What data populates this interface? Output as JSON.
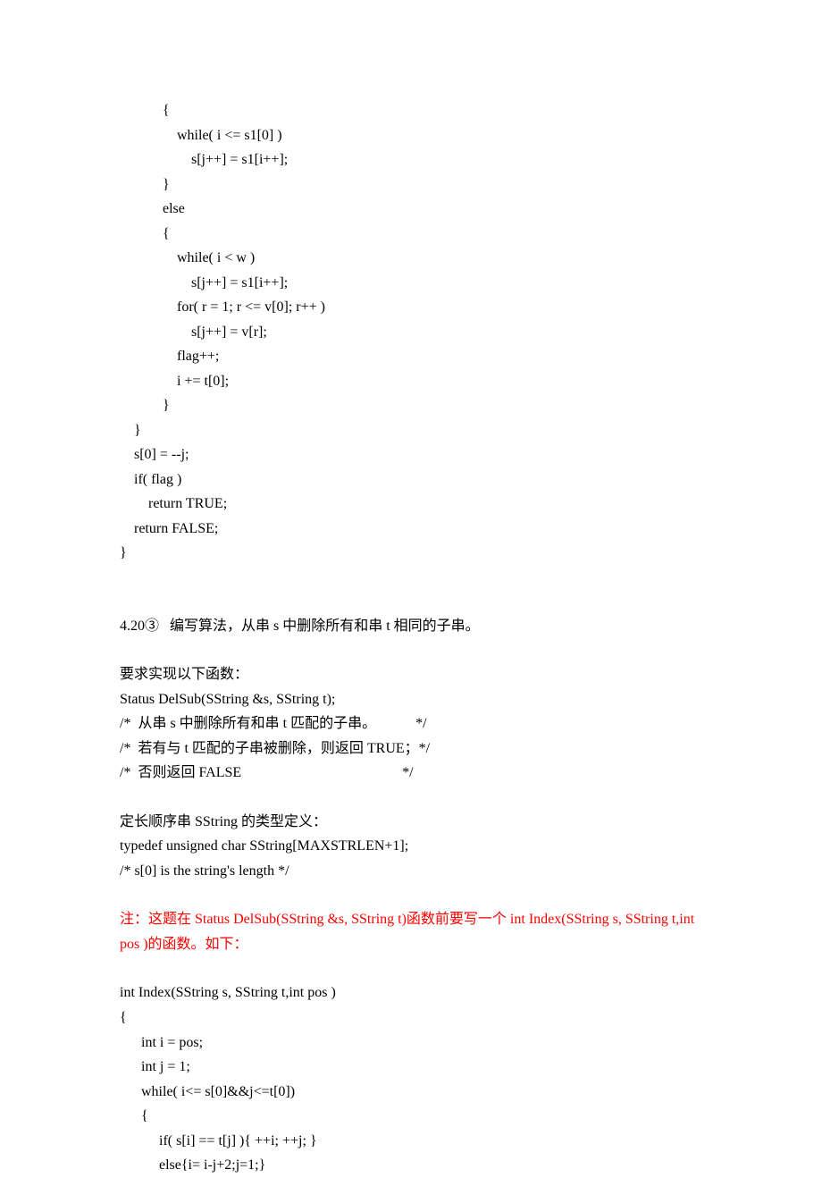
{
  "code_block_1": [
    "            {",
    "                while( i <= s1[0] )",
    "                    s[j++] = s1[i++];",
    "            }",
    "            else",
    "            {",
    "                while( i < w )",
    "                    s[j++] = s1[i++];",
    "                for( r = 1; r <= v[0]; r++ )",
    "                    s[j++] = v[r];",
    "                flag++;",
    "                i += t[0];",
    "            }",
    "    }",
    "    s[0] = --j;",
    "    if( flag )",
    "        return TRUE;",
    "    return FALSE;",
    "}"
  ],
  "problem_title": "4.20③   编写算法，从串 s 中删除所有和串 t 相同的子串。",
  "req_heading": "要求实现以下函数：",
  "func_sig": "Status DelSub(SString &s, SString t);",
  "comment_1": "/*  从串 s 中删除所有和串 t 匹配的子串。           */",
  "comment_2": "/*  若有与 t 匹配的子串被删除，则返回 TRUE；*/",
  "comment_3": "/*  否则返回 FALSE                                             */",
  "typedef_heading": "定长顺序串 SString 的类型定义：",
  "typedef_line": "typedef unsigned char SString[MAXSTRLEN+1];",
  "typedef_comment": "/* s[0] is the string's length */",
  "note_red": "注：这题在 Status DelSub(SString &s, SString t)函数前要写一个 int Index(SString s, SString t,int pos )的函数。如下：",
  "code_block_2": [
    "int Index(SString s, SString t,int pos )",
    "{",
    "      int i = pos;",
    "      int j = 1;",
    "      while( i<= s[0]&&j<=t[0])",
    "      {",
    "           if( s[i] == t[j] ){ ++i; ++j; }",
    "           else{i= i-j+2;j=1;}"
  ]
}
